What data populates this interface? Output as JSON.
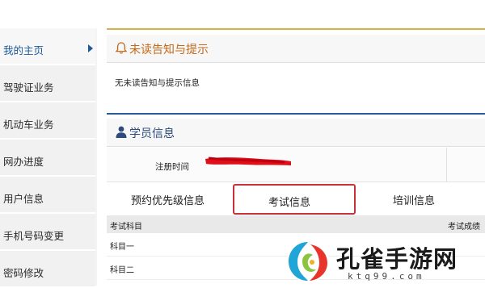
{
  "sidebar": {
    "items": [
      {
        "label": "我的主页",
        "active": true
      },
      {
        "label": "驾驶证业务"
      },
      {
        "label": "机动车业务"
      },
      {
        "label": "网办进度"
      },
      {
        "label": "用户信息"
      },
      {
        "label": "手机号码变更"
      },
      {
        "label": "密码修改"
      }
    ]
  },
  "notice": {
    "title": "未读告知与提示",
    "icon": "bell-icon",
    "message": "无未读告知与提示信息"
  },
  "student": {
    "title": "学员信息",
    "icon": "user-icon",
    "reg_label": "注册时间"
  },
  "tabs": [
    {
      "label": "预约优先级信息"
    },
    {
      "label": "考试信息",
      "selected": true
    },
    {
      "label": "培训信息"
    }
  ],
  "exam_table": {
    "columns": [
      "考试科目",
      "考试成绩"
    ],
    "rows": [
      {
        "subject": "科目一"
      },
      {
        "subject": "科目二"
      }
    ]
  },
  "watermark": {
    "text": "孔雀手游网",
    "sub": "ktq99.com"
  },
  "colors": {
    "accent_gold": "#d6b24c",
    "title_orange": "#c46818",
    "tab_highlight": "#c8303a",
    "link_blue": "#1c5a9a"
  }
}
